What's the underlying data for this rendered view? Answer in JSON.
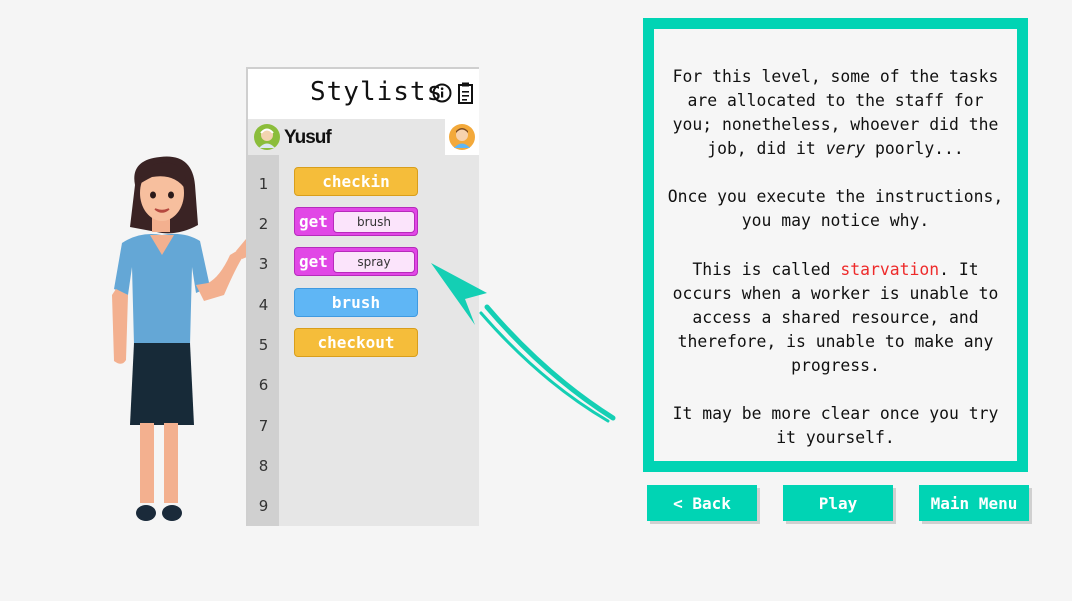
{
  "panel": {
    "title": "Stylists",
    "worker_name": "Yusuf",
    "line_numbers": [
      "1",
      "2",
      "3",
      "4",
      "5",
      "6",
      "7",
      "8",
      "9"
    ],
    "blocks": [
      {
        "line": 1,
        "label": "checkin",
        "color": "#f5bd3a"
      },
      {
        "line": 2,
        "label": "get",
        "arg": "brush",
        "color": "#e147e6"
      },
      {
        "line": 3,
        "label": "get",
        "arg": "spray",
        "color": "#e147e6"
      },
      {
        "line": 4,
        "label": "brush",
        "color": "#5fb6f5"
      },
      {
        "line": 5,
        "label": "checkout",
        "color": "#f5bd3a"
      }
    ]
  },
  "dialog": {
    "p1_a": "For this level, some of the tasks are allocated to the staff for you; nonetheless, whoever did the job, did it ",
    "p1_em": "very",
    "p1_b": " poorly...",
    "p2": "Once you execute the instructions, you may notice why.",
    "p3_a": "This is called ",
    "p3_red": "starvation",
    "p3_b": ".  It occurs when a worker is unable to access a shared resource, and therefore, is unable to make any progress.",
    "p4": "It may be more clear once you try it yourself."
  },
  "buttons": {
    "back": "< Back",
    "play": "Play",
    "main_menu": "Main Menu"
  },
  "colors": {
    "accent": "#00d4b4",
    "highlight": "#ee2b2b"
  },
  "icons": [
    "info-icon",
    "clipboard-icon",
    "worker-avatar-icon",
    "arrow-icon"
  ]
}
